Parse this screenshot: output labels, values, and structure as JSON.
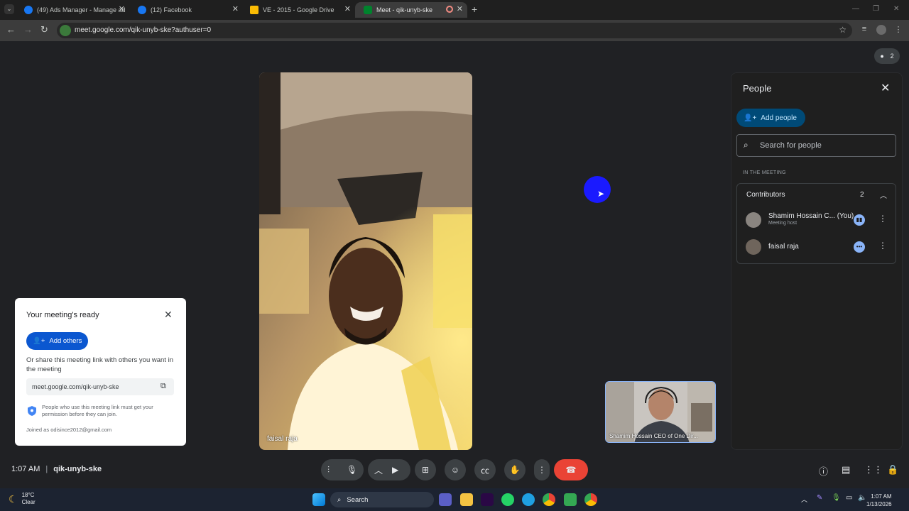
{
  "browser": {
    "tabs": [
      {
        "title": "(49) Ads Manager - Manage ad",
        "active": false,
        "favicon_color": "#1877f2"
      },
      {
        "title": "(12) Facebook",
        "active": false,
        "favicon_color": "#1877f2"
      },
      {
        "title": "VE - 2015 - Google Drive",
        "active": false,
        "favicon_color": "#fbbc04"
      },
      {
        "title": "Meet - qik-unyb-ske",
        "active": true,
        "favicon_color": "#00832d"
      }
    ],
    "url": "meet.google.com/qik-unyb-ske?authuser=0"
  },
  "meet": {
    "participant_count": "2",
    "main_tile_name": "faisal raja",
    "self_tile_name": "Shamim Hossain CEO of One Dir..."
  },
  "people_panel": {
    "title": "People",
    "add_people_label": "Add people",
    "search_placeholder": "Search for people",
    "section_label": "IN THE MEETING",
    "group_label": "Contributors",
    "group_count": "2",
    "participants": [
      {
        "name": "Shamim Hossain C... (You)",
        "subtitle": "Meeting host",
        "status": "speaking"
      },
      {
        "name": "faisal raja",
        "subtitle": "",
        "status": "more"
      }
    ]
  },
  "ready_card": {
    "title": "Your meeting's ready",
    "add_others_label": "Add others",
    "share_text": "Or share this meeting link with others you want in the meeting",
    "link": "meet.google.com/qik-unyb-ske",
    "permission_text": "People who use this meeting link must get your permission before they can join.",
    "joined_text": "Joined as odisince2012@gmail.com"
  },
  "bottom_bar": {
    "time": "1:07 AM",
    "separator": "|",
    "meeting_code": "qik-unyb-ske"
  },
  "taskbar": {
    "weather_temp": "18°C",
    "weather_desc": "Clear",
    "search_label": "Search",
    "time": "1:07 AM",
    "date": "1/13/2026"
  },
  "colors": {
    "end_call": "#ea4335",
    "accent_blue": "#0b57d0",
    "meet_bg": "#202124"
  }
}
